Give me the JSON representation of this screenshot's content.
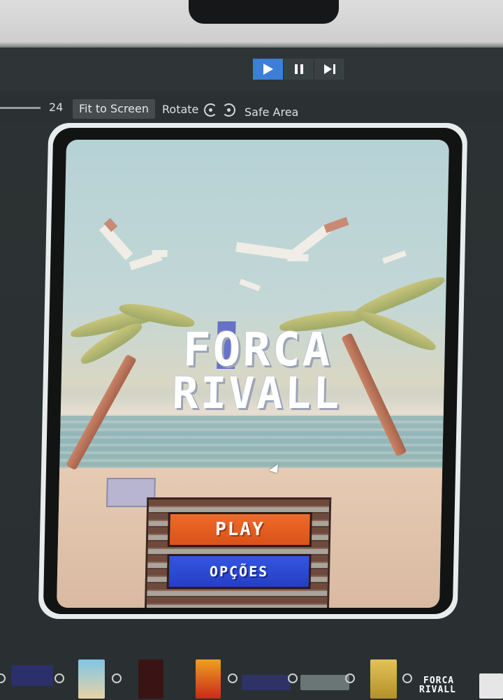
{
  "toolbar": {
    "zoom_value": "24",
    "fit_label": "Fit to Screen",
    "rotate_label": "Rotate",
    "safe_area_label": "Safe Area"
  },
  "playback": {
    "play_icon": "play-icon",
    "pause_icon": "pause-icon",
    "step_icon": "step-forward-icon",
    "active": "play"
  },
  "game": {
    "logo_line1": "FORCA",
    "logo_line2": "RIVALL",
    "play_label": "PLAY",
    "options_label": "OPÇÕES"
  },
  "thumbnails": {
    "logo_line1": "FORCA",
    "logo_line2": "RIVALL"
  },
  "colors": {
    "play_accent": "#3c7fd8",
    "play_button": "#e55f22",
    "options_button": "#2c4ad4",
    "logo_accent": "#5660c6"
  }
}
